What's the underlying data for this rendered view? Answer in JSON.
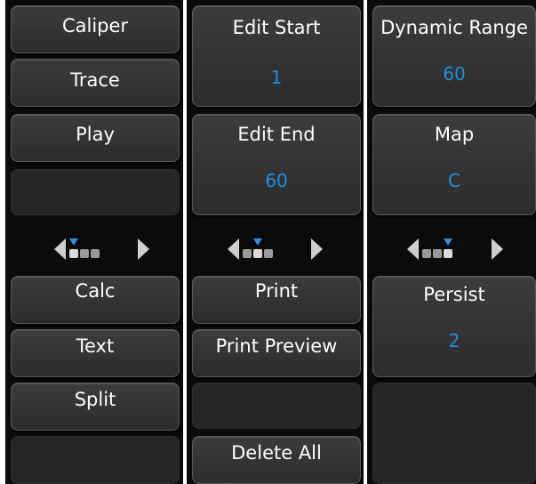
{
  "col1": {
    "top_buttons": [
      {
        "label": "Caliper"
      },
      {
        "label": "Trace"
      },
      {
        "label": "Play"
      }
    ],
    "bottom_buttons": [
      {
        "label": "Calc"
      },
      {
        "label": "Text"
      },
      {
        "label": "Split"
      }
    ],
    "page_indicator": {
      "current_page": 1,
      "page_count": 3
    }
  },
  "col2": {
    "top_buttons": [
      {
        "label": "Edit Start",
        "value": "1"
      },
      {
        "label": "Edit End",
        "value": "60"
      }
    ],
    "bottom_buttons": [
      {
        "label": "Print"
      },
      {
        "label": "Print Preview"
      },
      {
        "label": "Delete All"
      }
    ],
    "page_indicator": {
      "current_page": 2,
      "page_count": 3
    }
  },
  "col3": {
    "top_buttons": [
      {
        "label": "Dynamic Range",
        "value": "60"
      },
      {
        "label": "Map",
        "value": "C"
      }
    ],
    "bottom_buttons": [
      {
        "label": "Persist",
        "value": "2"
      }
    ],
    "page_indicator": {
      "current_page": 3,
      "page_count": 3
    }
  },
  "colors": {
    "value_text": "#1e90e0",
    "panel_bg": "#0b0b0b",
    "active_marker": "#2f8fe0"
  }
}
